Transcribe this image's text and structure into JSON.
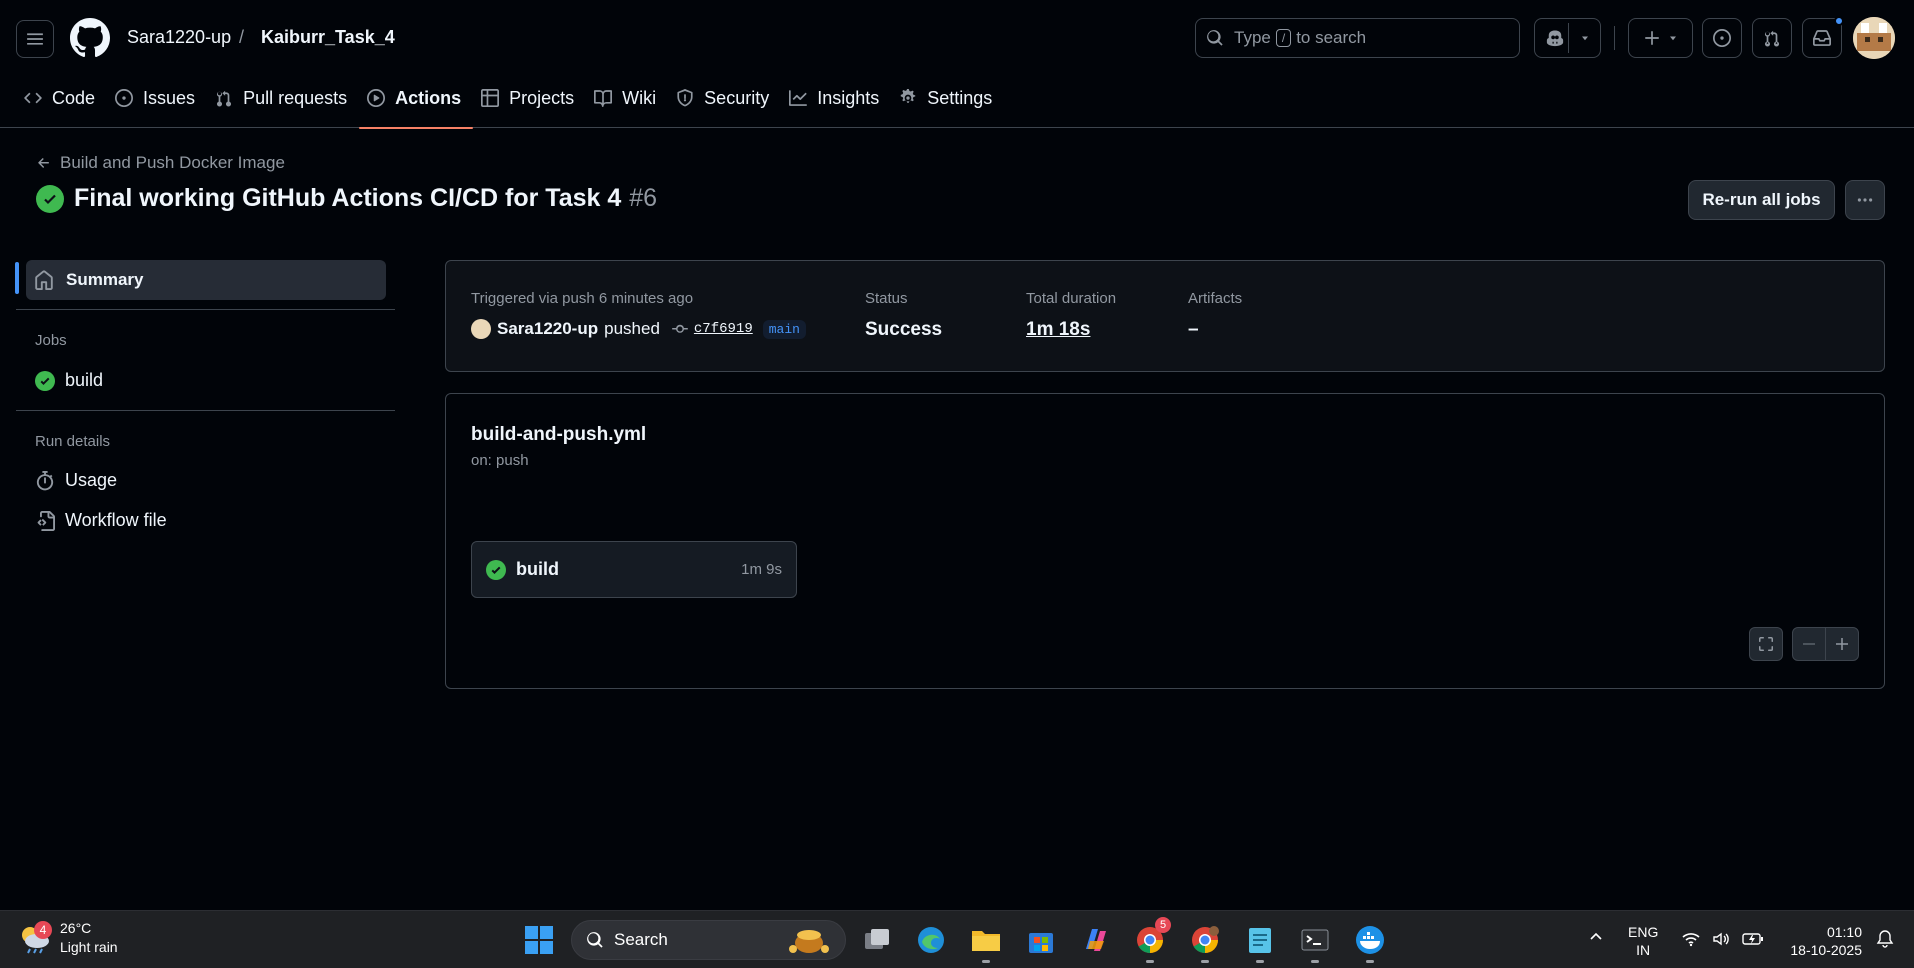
{
  "header": {
    "owner": "Sara1220-up",
    "separator": "/",
    "repo": "Kaiburr_Task_4",
    "search": {
      "prefix": "Type",
      "key": "/",
      "suffix": "to search"
    }
  },
  "tabs": [
    {
      "label": "Code",
      "icon": "code-icon"
    },
    {
      "label": "Issues",
      "icon": "issue-icon"
    },
    {
      "label": "Pull requests",
      "icon": "pull-request-icon"
    },
    {
      "label": "Actions",
      "icon": "play-icon",
      "active": true
    },
    {
      "label": "Projects",
      "icon": "table-icon"
    },
    {
      "label": "Wiki",
      "icon": "book-icon"
    },
    {
      "label": "Security",
      "icon": "shield-icon"
    },
    {
      "label": "Insights",
      "icon": "graph-icon"
    },
    {
      "label": "Settings",
      "icon": "gear-icon"
    }
  ],
  "run": {
    "workflow_back": "Build and Push Docker Image",
    "title": "Final working GitHub Actions CI/CD for Task 4",
    "number": "#6",
    "rerun_label": "Re-run all jobs"
  },
  "sidebar": {
    "summary_label": "Summary",
    "jobs_heading": "Jobs",
    "jobs": [
      {
        "label": "build",
        "status": "success"
      }
    ],
    "run_details_heading": "Run details",
    "details": [
      {
        "label": "Usage",
        "icon": "stopwatch-icon"
      },
      {
        "label": "Workflow file",
        "icon": "file-code-icon"
      }
    ]
  },
  "summary": {
    "trigger_label": "Triggered via push 6 minutes ago",
    "actor": "Sara1220-up",
    "action": "pushed",
    "commit": "c7f6919",
    "branch": "main",
    "status_label": "Status",
    "status_value": "Success",
    "duration_label": "Total duration",
    "duration_value": "1m 18s",
    "artifacts_label": "Artifacts",
    "artifacts_value": "–"
  },
  "graph": {
    "workflow_file": "build-and-push.yml",
    "on": "on: push",
    "job": {
      "name": "build",
      "duration": "1m 9s"
    }
  },
  "taskbar": {
    "weather_badge": "4",
    "temperature": "26°C",
    "condition": "Light rain",
    "search_label": "Search",
    "chrome_badge": "5",
    "lang_top": "ENG",
    "lang_bottom": "IN",
    "time": "01:10",
    "date": "18-10-2025"
  },
  "colors": {
    "accent_success": "#3fb950",
    "accent_link": "#4493f8",
    "tab_underline": "#f78166"
  }
}
